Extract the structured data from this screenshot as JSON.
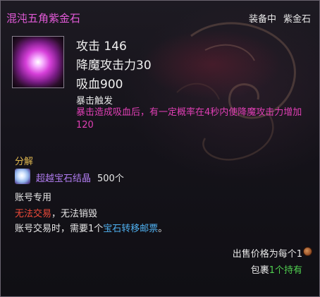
{
  "item": {
    "name": "混沌五角紫金石",
    "status_equipped": "装备中",
    "status_type": "紫金石",
    "icon": "purple-gem-icon"
  },
  "stats": {
    "attack": "攻击 146",
    "demon_attack": "降魔攻击力30",
    "lifesteal": "吸血900"
  },
  "effect": {
    "title": "暴击触发",
    "description": "暴击造成吸血后，有一定概率在4秒内使降魔攻击力增加120"
  },
  "decompose": {
    "label": "分解",
    "material_icon": "crystal-icon",
    "material_name": "超越宝石结晶",
    "material_count": "500个"
  },
  "restrictions": {
    "account_bound": "账号专用",
    "no_trade": "无法交易",
    "no_destroy": "，无法销毁",
    "note_prefix": "账号交易时，需要1个",
    "note_link": "宝石转移邮票",
    "note_suffix": "。"
  },
  "price": {
    "label": "出售价格为每个1",
    "icon": "copper-coin-icon"
  },
  "bag": {
    "label": "包裹",
    "count": "1个持有"
  },
  "colors": {
    "name": "#e35ad8",
    "effect": "#e03fb5",
    "decompose": "#e0b850",
    "material": "#b07cf0",
    "warning": "#f04a3a",
    "link": "#4fb0f0",
    "owned": "#50d050"
  }
}
